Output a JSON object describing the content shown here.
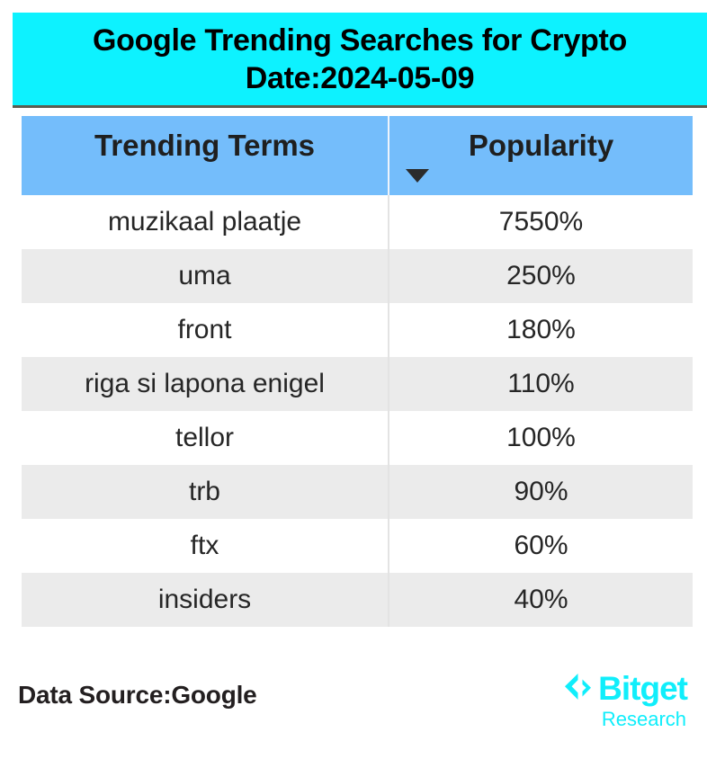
{
  "banner": {
    "title_line1": "Google Trending Searches for Crypto",
    "title_line2": "Date:2024-05-09",
    "background_color": "#0df2ff"
  },
  "table": {
    "header_background_color": "#74bdfb",
    "columns": [
      {
        "label": "Trending Terms",
        "sort_icon": ""
      },
      {
        "label": "Popularity",
        "sort_icon": "sort-descending-icon"
      }
    ],
    "rows": [
      {
        "term": "muzikaal plaatje",
        "popularity": "7550%"
      },
      {
        "term": "uma",
        "popularity": "250%"
      },
      {
        "term": "front",
        "popularity": "180%"
      },
      {
        "term": "riga si lapona enigel",
        "popularity": "110%"
      },
      {
        "term": "tellor",
        "popularity": "100%"
      },
      {
        "term": "trb",
        "popularity": "90%"
      },
      {
        "term": "ftx",
        "popularity": "60%"
      },
      {
        "term": "insiders",
        "popularity": "40%"
      }
    ]
  },
  "footer": {
    "data_source": "Data Source:Google",
    "brand_name": "Bitget",
    "brand_sub": "Research",
    "brand_color": "#10eefb"
  },
  "chart_data": {
    "type": "table",
    "title": "Google Trending Searches for Crypto Date:2024-05-09",
    "columns": [
      "Trending Terms",
      "Popularity"
    ],
    "categories": [
      "muzikaal plaatje",
      "uma",
      "front",
      "riga si lapona enigel",
      "tellor",
      "trb",
      "ftx",
      "insiders"
    ],
    "values": [
      7550,
      250,
      180,
      110,
      100,
      90,
      60,
      40
    ],
    "value_unit": "%",
    "sorted_by": "Popularity",
    "sort_order": "descending",
    "xlabel": "Trending Terms",
    "ylabel": "Popularity"
  }
}
